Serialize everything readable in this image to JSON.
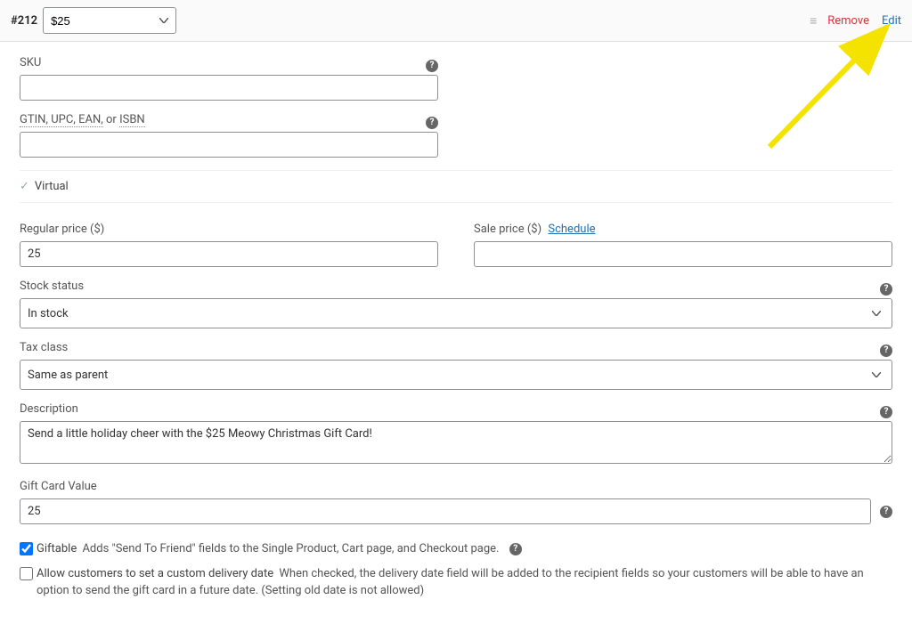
{
  "header": {
    "variation_id": "#212",
    "variation_select_value": "$25",
    "remove": "Remove",
    "edit": "Edit"
  },
  "fields": {
    "sku_label": "SKU",
    "sku_value": "",
    "gtin_label_part1": "GTIN, UPC, EAN,",
    "gtin_label_part2": " or ",
    "gtin_label_part3": "ISBN",
    "gtin_value": "",
    "virtual_label": "Virtual",
    "regular_price_label": "Regular price ($)",
    "regular_price_value": "25",
    "sale_price_label": "Sale price ($)",
    "schedule_link": "Schedule",
    "sale_price_value": "",
    "stock_status_label": "Stock status",
    "stock_status_value": "In stock",
    "tax_class_label": "Tax class",
    "tax_class_value": "Same as parent",
    "description_label": "Description",
    "description_value": "Send a little holiday cheer with the $25 Meowy Christmas Gift Card!",
    "gift_card_value_label": "Gift Card Value",
    "gift_card_value": "25",
    "giftable_label": "Giftable",
    "giftable_desc": "Adds \"Send To Friend\" fields to the Single Product, Cart page, and Checkout page.",
    "allow_custom_date_label": "Allow customers to set a custom delivery date",
    "allow_custom_date_desc": "When checked, the delivery date field will be added to the recipient fields so your customers will be able to have an option to send the gift card in a future date. (Setting old date is not allowed)"
  }
}
